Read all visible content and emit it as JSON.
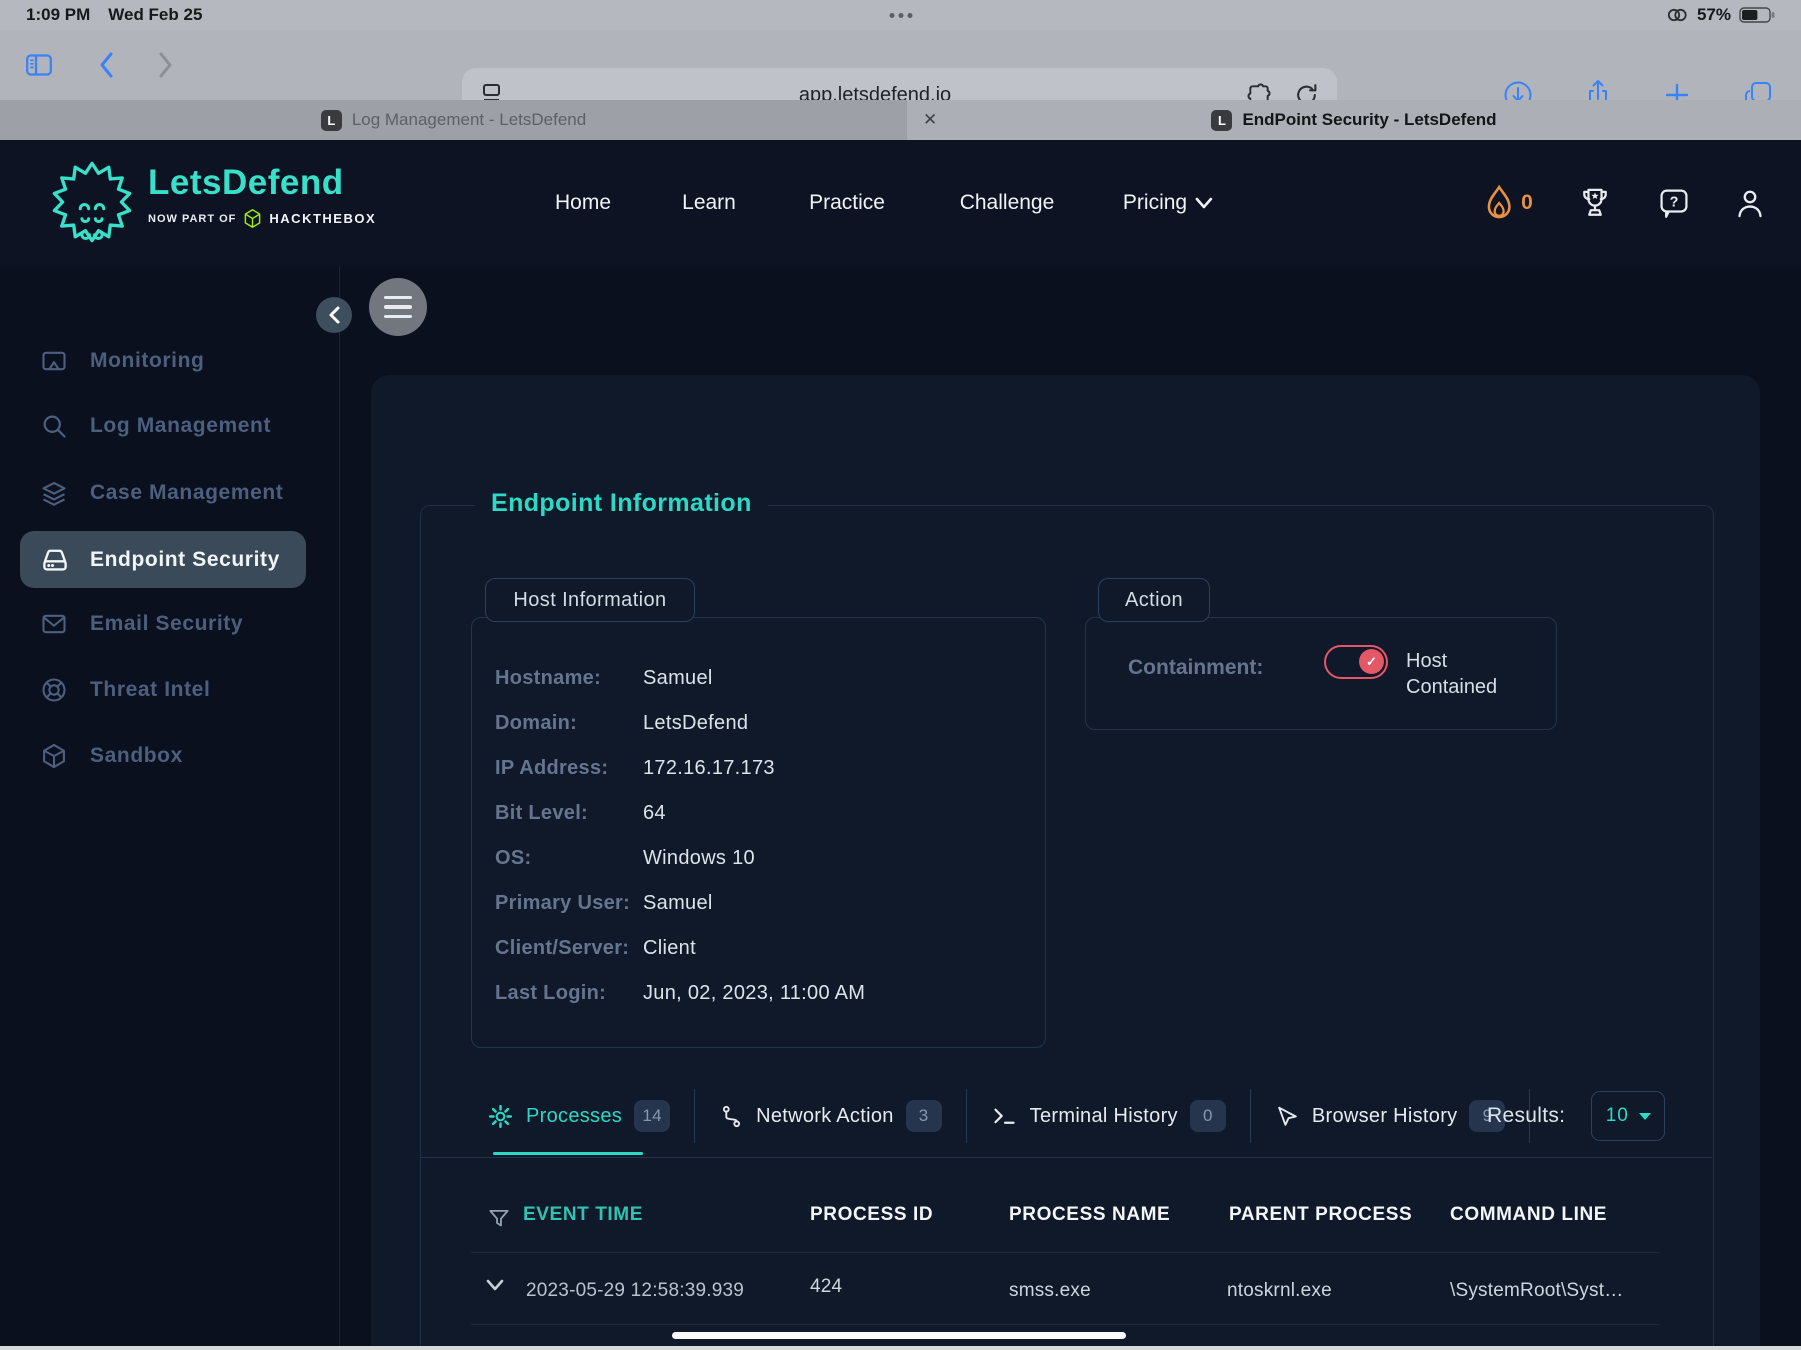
{
  "status_bar": {
    "time": "1:09 PM",
    "date": "Wed Feb 25",
    "battery_percent": "57%"
  },
  "browser": {
    "url": "app.letsdefend.io",
    "tabs": [
      {
        "favicon": "L",
        "title": "Log Management - LetsDefend",
        "active": false
      },
      {
        "favicon": "L",
        "title": "EndPoint Security - LetsDefend",
        "active": true
      }
    ],
    "close_glyph": "✕"
  },
  "header": {
    "logo_title": "LetsDefend",
    "logo_subtitle": "NOW PART OF",
    "logo_partner": "HACKTHEBOX",
    "nav": [
      {
        "label": "Home"
      },
      {
        "label": "Learn"
      },
      {
        "label": "Practice"
      },
      {
        "label": "Challenge"
      },
      {
        "label": "Pricing"
      }
    ],
    "streak_count": "0"
  },
  "sidebar": {
    "items": [
      {
        "label": "Monitoring",
        "icon": "monitor-share-icon",
        "active": false
      },
      {
        "label": "Log Management",
        "icon": "search-icon",
        "active": false
      },
      {
        "label": "Case Management",
        "icon": "layers-icon",
        "active": false
      },
      {
        "label": "Endpoint Security",
        "icon": "hard-drive-icon",
        "active": true
      },
      {
        "label": "Email Security",
        "icon": "envelope-icon",
        "active": false
      },
      {
        "label": "Threat Intel",
        "icon": "life-buoy-icon",
        "active": false
      },
      {
        "label": "Sandbox",
        "icon": "cube-icon",
        "active": false
      }
    ]
  },
  "main": {
    "section_title": "Endpoint Information",
    "host_info": {
      "legend": "Host Information",
      "rows": [
        {
          "label": "Hostname:",
          "value": "Samuel"
        },
        {
          "label": "Domain:",
          "value": "LetsDefend"
        },
        {
          "label": "IP Address:",
          "value": "172.16.17.173"
        },
        {
          "label": "Bit Level:",
          "value": "64"
        },
        {
          "label": "OS:",
          "value": "Windows 10"
        },
        {
          "label": "Primary User:",
          "value": "Samuel"
        },
        {
          "label": "Client/Server:",
          "value": "Client"
        },
        {
          "label": "Last Login:",
          "value": "Jun, 02, 2023, 11:00 AM"
        }
      ]
    },
    "action": {
      "legend": "Action",
      "containment_label": "Containment:",
      "toggle_state_line1": "Host",
      "toggle_state_line2": "Contained",
      "toggle_check": "✓"
    },
    "tabs": [
      {
        "label": "Processes",
        "count": "14",
        "icon": "gear-icon",
        "selected": true
      },
      {
        "label": "Network Action",
        "count": "3",
        "icon": "branch-icon",
        "selected": false
      },
      {
        "label": "Terminal History",
        "count": "0",
        "icon": "terminal-icon",
        "selected": false
      },
      {
        "label": "Browser History",
        "count": "9",
        "icon": "cursor-icon",
        "selected": false
      }
    ],
    "results": {
      "label": "Results:",
      "value": "10"
    },
    "table": {
      "headers": [
        "EVENT TIME",
        "PROCESS ID",
        "PROCESS NAME",
        "PARENT PROCESS",
        "COMMAND LINE"
      ],
      "rows": [
        {
          "time": "2023-05-29 12:58:39.939",
          "pid": "424",
          "name": "smss.exe",
          "parent": "ntoskrnl.exe",
          "cmd": "\\SystemRoot\\Syst…"
        }
      ]
    }
  },
  "colors": {
    "accent_teal": "#2bd9c5",
    "toggle_red": "#e35767",
    "flame_orange": "#e8913f",
    "htb_green": "#9fef00",
    "safari_blue": "#3a82f7",
    "sidebar_muted": "#4d5f7e",
    "card_bg": "#0f1929"
  }
}
